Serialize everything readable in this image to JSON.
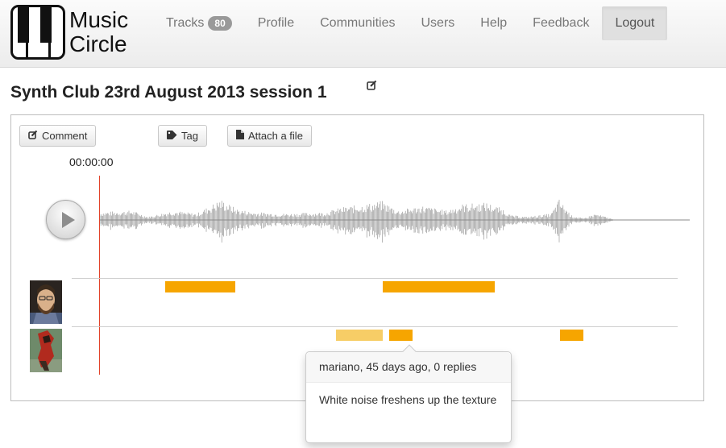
{
  "app": {
    "logo_text": [
      "Music",
      "Circle"
    ],
    "logo_icon": "piano-keys-icon"
  },
  "nav": {
    "tracks": {
      "label": "Tracks",
      "badge": "80"
    },
    "profile": "Profile",
    "communities": "Communities",
    "users": "Users",
    "help": "Help",
    "feedback": "Feedback",
    "logout": "Logout"
  },
  "page": {
    "title": "Synth Club 23rd August 2013 session 1",
    "edit_icon": "edit-icon"
  },
  "toolbar": {
    "comment": {
      "label": "Comment",
      "icon": "edit-icon"
    },
    "tag": {
      "label": "Tag",
      "icon": "tag-icon"
    },
    "attach": {
      "label": "Attach a file",
      "icon": "file-icon"
    }
  },
  "player": {
    "time": "00:00:00",
    "play_icon": "play-icon"
  },
  "annotations": [
    {
      "user": "bearded-man",
      "segments": [
        {
          "start": 0.11,
          "end": 0.23
        },
        {
          "start": 0.48,
          "end": 0.67
        }
      ]
    },
    {
      "user": "mariano",
      "segments": [
        {
          "start": 0.4,
          "end": 0.48,
          "active": true
        },
        {
          "start": 0.49,
          "end": 0.53
        },
        {
          "start": 0.78,
          "end": 0.82
        }
      ]
    }
  ],
  "popover": {
    "header": "mariano, 45 days ago, 0 replies",
    "body": "White noise freshens up the texture"
  },
  "colors": {
    "accent": "#f6a500",
    "accent_active": "#f7cd66",
    "playhead": "#e2432a",
    "waveform": "#8a8a8a"
  }
}
